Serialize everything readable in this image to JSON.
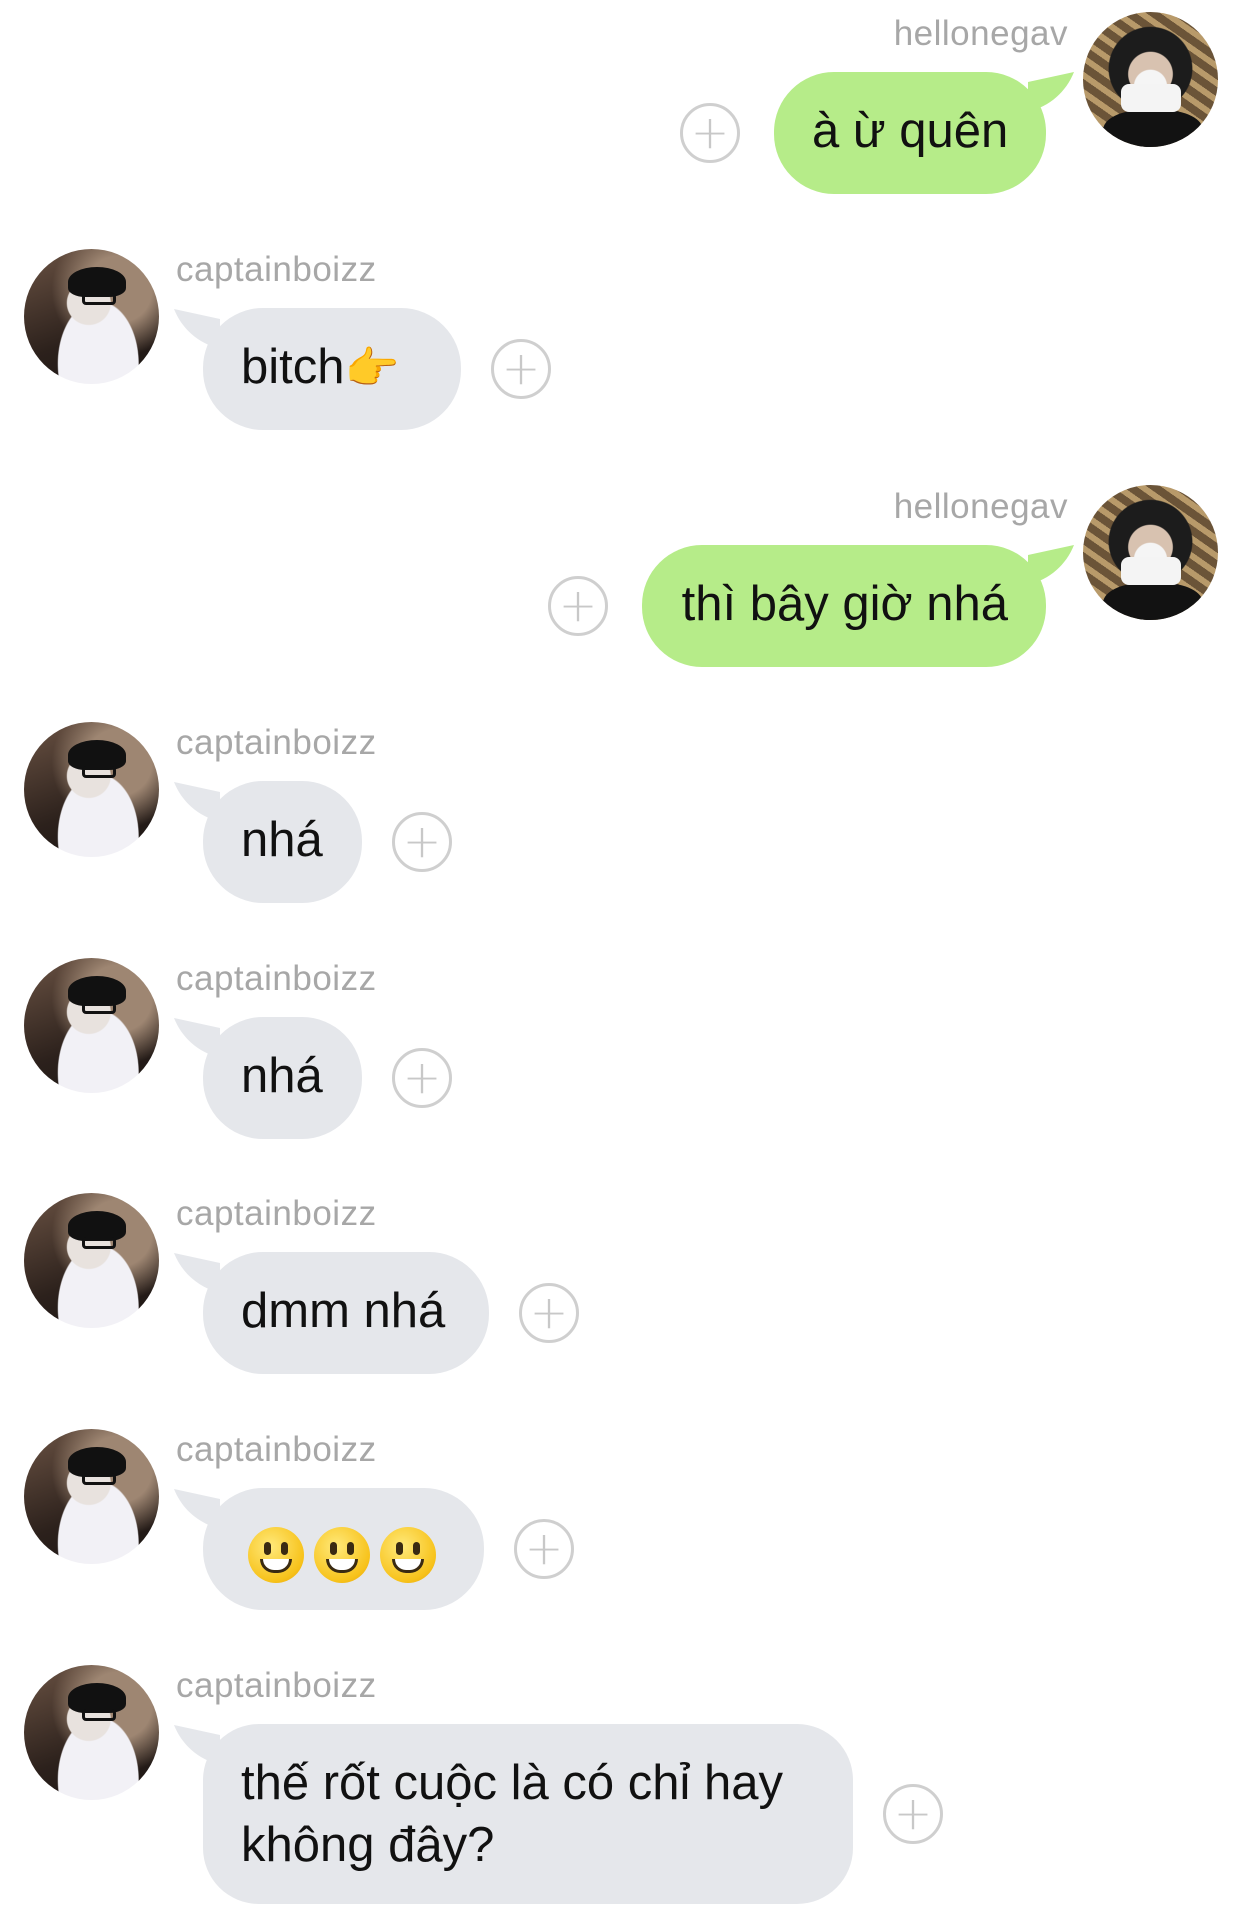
{
  "conversation": {
    "messages": [
      {
        "sender": "hellonegav",
        "text": "à ừ quên",
        "side": "mine"
      },
      {
        "sender": "captainboizz",
        "text": "bitch",
        "emoji": "👉",
        "side": "other"
      },
      {
        "sender": "hellonegav",
        "text": "thì bây giờ nhá",
        "side": "mine"
      },
      {
        "sender": "captainboizz",
        "text": "nhá",
        "side": "other"
      },
      {
        "sender": "captainboizz",
        "text": "nhá",
        "side": "other"
      },
      {
        "sender": "captainboizz",
        "text": "dmm nhá",
        "side": "other"
      },
      {
        "sender": "captainboizz",
        "text": "😃😃😃",
        "side": "other"
      },
      {
        "sender": "captainboizz",
        "text_line1": "thế rốt cuộc là có chỉ hay",
        "text_line2": "không đây?",
        "side": "other"
      }
    ],
    "react_icon": "plus-circle-icon",
    "colors": {
      "my_bubble": "#b6ec89",
      "other_bubble": "#e5e7eb",
      "name": "#a7a7a7"
    }
  }
}
